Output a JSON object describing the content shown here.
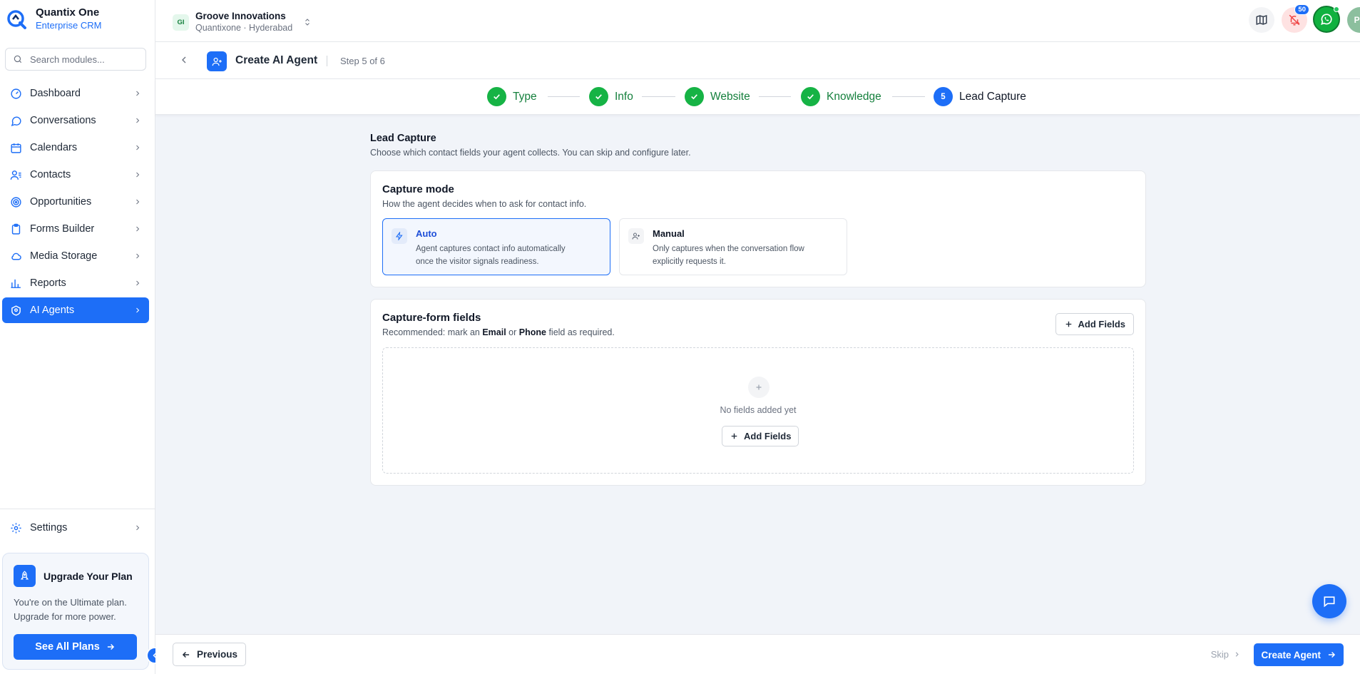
{
  "brand": {
    "name": "Quantix One",
    "subtitle": "Enterprise CRM"
  },
  "search": {
    "placeholder": "Search modules..."
  },
  "sidebar": {
    "items": [
      {
        "label": "Dashboard",
        "icon": "dashboard-icon"
      },
      {
        "label": "Conversations",
        "icon": "chat-icon"
      },
      {
        "label": "Calendars",
        "icon": "calendar-icon"
      },
      {
        "label": "Contacts",
        "icon": "contacts-icon"
      },
      {
        "label": "Opportunities",
        "icon": "target-icon"
      },
      {
        "label": "Forms Builder",
        "icon": "clipboard-icon"
      },
      {
        "label": "Media Storage",
        "icon": "cloud-icon"
      },
      {
        "label": "Reports",
        "icon": "bar-chart-icon"
      },
      {
        "label": "AI Agents",
        "icon": "robot-icon",
        "active": true
      }
    ],
    "settings_label": "Settings"
  },
  "upgrade": {
    "title": "Upgrade Your Plan",
    "text_line1": "You're on the Ultimate plan.",
    "text_line2": "Upgrade for more power.",
    "button": "See All Plans"
  },
  "workspace": {
    "badge": "GI",
    "name": "Groove Innovations",
    "location": "Quantixone · Hyderabad"
  },
  "topbar": {
    "notifications_count": "50",
    "avatar_initials": "PR"
  },
  "header": {
    "title": "Create AI Agent",
    "step": "Step 5 of 6"
  },
  "stepper": {
    "steps": [
      {
        "label": "Type",
        "status": "done"
      },
      {
        "label": "Info",
        "status": "done"
      },
      {
        "label": "Website",
        "status": "done"
      },
      {
        "label": "Knowledge",
        "status": "done"
      },
      {
        "label": "Lead Capture",
        "status": "current",
        "number": "5"
      }
    ]
  },
  "section": {
    "title": "Lead Capture",
    "subtitle": "Choose which contact fields your agent collects. You can skip and configure later."
  },
  "capture_mode": {
    "title": "Capture mode",
    "subtitle": "How the agent decides when to ask for contact info.",
    "selected": "Auto",
    "options": [
      {
        "title": "Auto",
        "desc_line1": "Agent captures contact info automatically",
        "desc_line2": "once the visitor signals readiness."
      },
      {
        "title": "Manual",
        "desc_line1": "Only captures when the conversation flow",
        "desc_line2": "explicitly requests it."
      }
    ]
  },
  "fields": {
    "title": "Capture-form fields",
    "sub_prefix": "Recommended: mark an ",
    "sub_email": "Email",
    "sub_or": " or ",
    "sub_phone": "Phone",
    "sub_suffix": " field as required.",
    "add_button": "Add Fields",
    "empty_text": "No fields added yet",
    "empty_add_button": "Add Fields"
  },
  "footer": {
    "previous": "Previous",
    "skip": "Skip",
    "create": "Create Agent"
  },
  "colors": {
    "primary": "#1d6ef7",
    "success": "#16b345",
    "background": "#f1f4f9"
  }
}
